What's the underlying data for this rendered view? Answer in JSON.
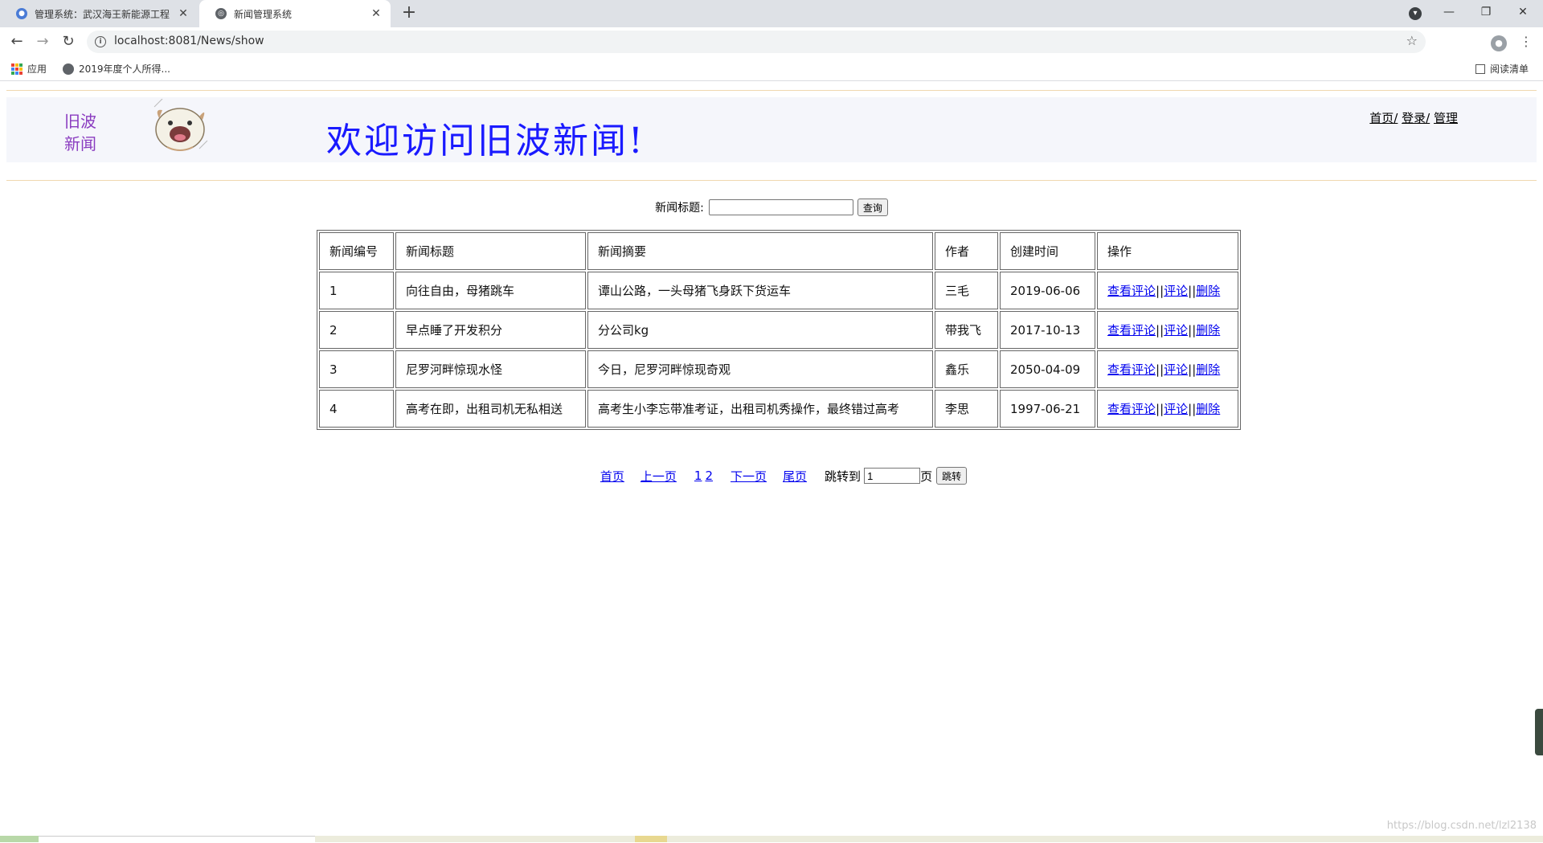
{
  "browser": {
    "tabs": [
      {
        "title": "管理系统：武汉海王新能源工程",
        "active": false
      },
      {
        "title": "新闻管理系统",
        "active": true
      }
    ],
    "url": "localhost:8081/News/show",
    "bookmarks": [
      {
        "label": "应用",
        "icon": "apps-icon"
      },
      {
        "label": "2019年度个人所得...",
        "icon": "globe-icon"
      }
    ],
    "reading_list": "阅读清单"
  },
  "header": {
    "logo_line1": "旧波",
    "logo_line2": "新闻",
    "welcome": "欢迎访问旧波新闻!",
    "nav": {
      "home": "首页/",
      "login": "登录/",
      "admin": "管理"
    }
  },
  "search": {
    "label": "新闻标题:",
    "value": "",
    "button": "查询"
  },
  "table": {
    "headers": [
      "新闻编号",
      "新闻标题",
      "新闻摘要",
      "作者",
      "创建时间",
      "操作"
    ],
    "rows": [
      {
        "id": "1",
        "title": "向往自由，母猪跳车",
        "summary": "谭山公路，一头母猪飞身跃下货运车",
        "author": "三毛",
        "created": "2019-06-06"
      },
      {
        "id": "2",
        "title": "早点睡了开发积分",
        "summary": "分公司kg",
        "author": "带我飞",
        "created": "2017-10-13"
      },
      {
        "id": "3",
        "title": "尼罗河畔惊现水怪",
        "summary": "今日，尼罗河畔惊现奇观",
        "author": "鑫乐",
        "created": "2050-04-09"
      },
      {
        "id": "4",
        "title": "高考在即，出租司机无私相送",
        "summary": "高考生小李忘带准考证，出租司机秀操作，最终错过高考",
        "author": "李思",
        "created": "1997-06-21"
      }
    ],
    "actions": {
      "view": "查看评论",
      "sep": "||",
      "comment": "评论",
      "delete": "删除"
    }
  },
  "pager": {
    "first": "首页",
    "prev": "上一页",
    "pages": [
      "1",
      "2"
    ],
    "next": "下一页",
    "last": "尾页",
    "jump_label": "跳转到",
    "jump_value": "1",
    "page_unit": "页",
    "jump_button": "跳转"
  },
  "watermark": "https://blog.csdn.net/lzl2138",
  "colors": {
    "welcome": "#1a1aff",
    "logo": "#8a3cc0",
    "link": "#0000ee",
    "divider": "#f0d8b0"
  }
}
